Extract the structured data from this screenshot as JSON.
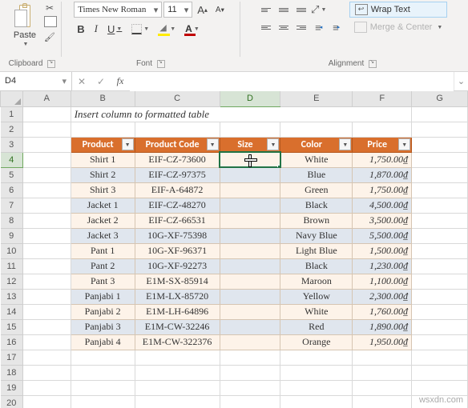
{
  "ribbon": {
    "clipboard": {
      "paste": "Paste",
      "label": "Clipboard"
    },
    "font": {
      "name": "Times New Roman",
      "size": "11",
      "grow": "A",
      "shrink": "A",
      "bold": "B",
      "italic": "I",
      "underline": "U",
      "label": "Font"
    },
    "alignment": {
      "wrap": "Wrap Text",
      "merge": "Merge & Center",
      "label": "Alignment"
    }
  },
  "namebox": {
    "ref": "D4"
  },
  "columns": [
    "A",
    "B",
    "C",
    "D",
    "E",
    "F",
    "G"
  ],
  "instruction": "Insert column to formatted table",
  "table": {
    "headers": [
      "Product",
      "Product Code",
      "Size",
      "Color",
      "Price"
    ],
    "rows": [
      [
        "Shirt 1",
        "EIF-CZ-73600",
        "",
        "White",
        "1,750.00₫"
      ],
      [
        "Shirt 2",
        "EIF-CZ-97375",
        "",
        "Blue",
        "1,870.00₫"
      ],
      [
        "Shirt 3",
        "EIF-A-64872",
        "",
        "Green",
        "1,750.00₫"
      ],
      [
        "Jacket 1",
        "EIF-CZ-48270",
        "",
        "Black",
        "4,500.00₫"
      ],
      [
        "Jacket 2",
        "EIF-CZ-66531",
        "",
        "Brown",
        "3,500.00₫"
      ],
      [
        "Jacket 3",
        "10G-XF-75398",
        "",
        "Navy Blue",
        "5,500.00₫"
      ],
      [
        "Pant 1",
        "10G-XF-96371",
        "",
        "Light Blue",
        "1,500.00₫"
      ],
      [
        "Pant 2",
        "10G-XF-92273",
        "",
        "Black",
        "1,230.00₫"
      ],
      [
        "Pant 3",
        "E1M-SX-85914",
        "",
        "Maroon",
        "1,100.00₫"
      ],
      [
        "Panjabi 1",
        "E1M-LX-85720",
        "",
        "Yellow",
        "2,300.00₫"
      ],
      [
        "Panjabi 2",
        "E1M-LH-64896",
        "",
        "White",
        "1,760.00₫"
      ],
      [
        "Panjabi 3",
        "E1M-CW-32246",
        "",
        "Red",
        "1,890.00₫"
      ],
      [
        "Panjabi 4",
        "E1M-CW-322376",
        "",
        "Orange",
        "1,950.00₫"
      ]
    ]
  },
  "row_start": 1,
  "row_end": 20,
  "watermark": "wsxdn.com"
}
